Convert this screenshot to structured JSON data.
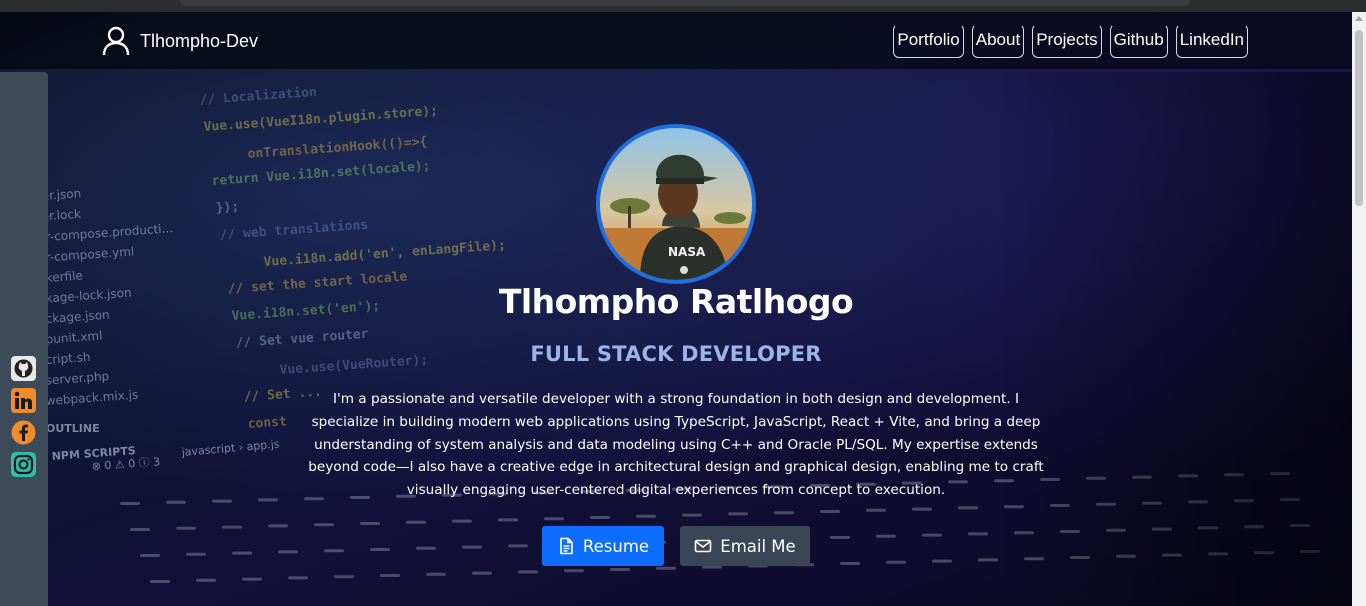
{
  "nav": {
    "brand": "Tlhompho-Dev",
    "brand_icon": "user-icon",
    "links": [
      {
        "label": "Portfolio"
      },
      {
        "label": "About"
      },
      {
        "label": "Projects"
      },
      {
        "label": "Github"
      },
      {
        "label": "LinkedIn"
      }
    ]
  },
  "social": [
    {
      "icon": "github-icon",
      "color": "#e8e8e8"
    },
    {
      "icon": "linkedin-icon",
      "color": "#f28c28"
    },
    {
      "icon": "facebook-icon",
      "color": "#f28c28"
    },
    {
      "icon": "instagram-icon",
      "color": "#2dbfa8"
    }
  ],
  "hero": {
    "name": "Tlhompho Ratlhogo",
    "role": "FULL STACK DEVELOPER",
    "bio": "I'm a passionate and versatile developer with a strong foundation in both design and development. I specialize in building modern web applications using TypeScript, JavaScript, React + Vite, and bring a deep understanding of system analysis and data modeling using C++ and Oracle PL/SQL. My expertise extends beyond code—I also have a creative edge in architectural design and graphical design, enabling me to craft visually engaging user-centered digital experiences from concept to execution.",
    "avatar_text": "NASA"
  },
  "buttons": {
    "resume": "Resume",
    "email": "Email Me"
  },
  "code_bg": {
    "lines": [
      "// Localization",
      "Vue.use(VueI18n.plugin.store);",
      "onTranslationHook(()=>{",
      "return Vue.i18n.set(locale);",
      "});",
      "// web translations",
      "Vue.i18n.add('en', enLangFile);",
      "// set the start locale",
      "Vue.i18n.set('en');",
      "// Set vue router",
      "Vue.use(VueRouter);",
      "// Set ...",
      "const"
    ],
    "files": [
      "er.json",
      "er.lock",
      "r-compose.producti...",
      "r-compose.yml",
      "kerfile",
      "kage-lock.json",
      "ckage.json",
      "punit.xml",
      "cript.sh",
      "server.php",
      "webpack.mix.js"
    ],
    "outline": "OUTLINE",
    "npm_scripts": "NPM SCRIPTS",
    "status": "⊗ 0 ⚠ 0  ⓘ 3",
    "breadcrumb": "javascript › app.js"
  },
  "colors": {
    "primary": "#0d6efd",
    "secondary": "#3a4655",
    "accent_text": "#9db4e8",
    "avatar_ring": "#1f6fe0"
  }
}
